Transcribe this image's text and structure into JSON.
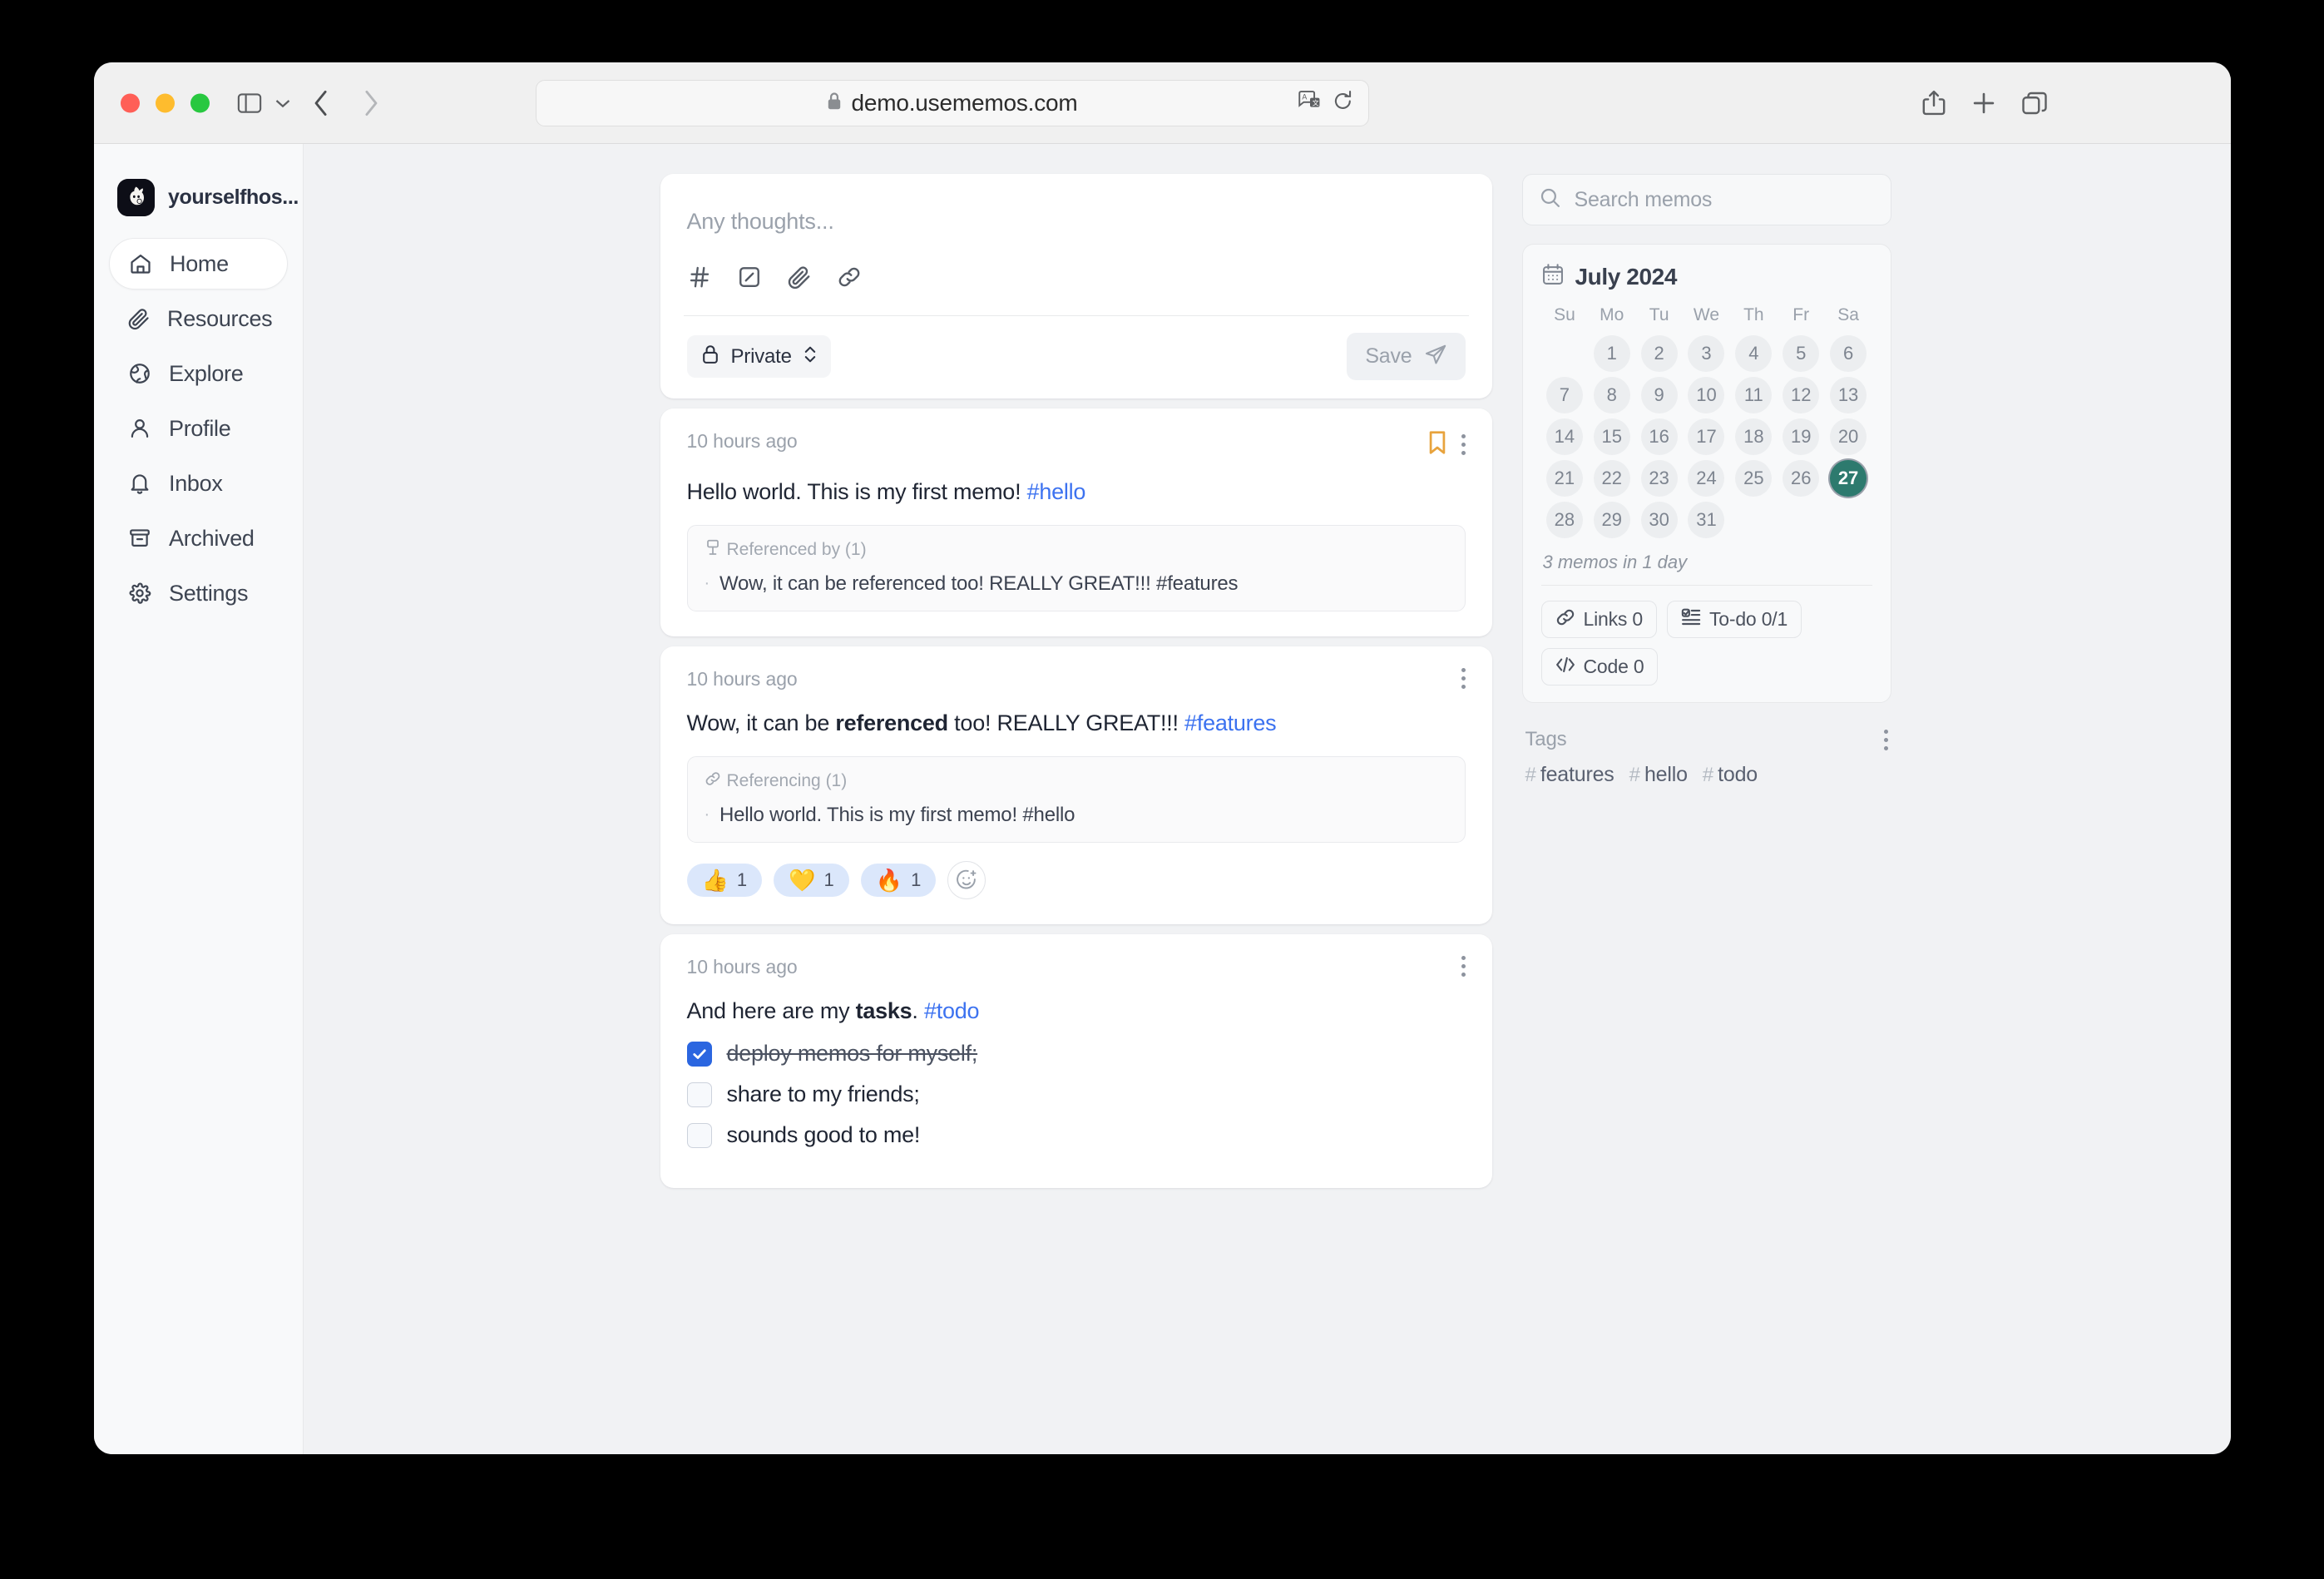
{
  "browser": {
    "url": "demo.usememos.com",
    "lock_icon": "lock-icon",
    "translate_icon": "translate-icon",
    "reload_icon": "reload-icon",
    "share_icon": "share-icon",
    "newtab_icon": "plus-icon",
    "tabs_icon": "tab-overview-icon",
    "back_icon": "chevron-left-icon",
    "forward_icon": "chevron-right-icon",
    "sidebar_icon": "sidebar-toggle-icon",
    "sidebar_chevron_icon": "chevron-down-icon"
  },
  "sidebar": {
    "username": "yourselfhos...",
    "avatar_name": "memos-mascot-avatar",
    "items": [
      {
        "label": "Home",
        "icon": "home-icon",
        "active": true
      },
      {
        "label": "Resources",
        "icon": "paperclip-icon",
        "active": false
      },
      {
        "label": "Explore",
        "icon": "globe-icon",
        "active": false
      },
      {
        "label": "Profile",
        "icon": "user-icon",
        "active": false
      },
      {
        "label": "Inbox",
        "icon": "bell-icon",
        "active": false
      },
      {
        "label": "Archived",
        "icon": "archive-icon",
        "active": false
      },
      {
        "label": "Settings",
        "icon": "gear-icon",
        "active": false
      }
    ]
  },
  "editor": {
    "placeholder": "Any thoughts...",
    "tools": [
      {
        "name": "hashtag-icon"
      },
      {
        "name": "checkbox-icon"
      },
      {
        "name": "paperclip-icon"
      },
      {
        "name": "link-icon"
      }
    ],
    "visibility": "Private",
    "visibility_icon": "lock-icon",
    "save_label": "Save",
    "save_icon": "send-icon",
    "save_enabled": false
  },
  "memos": [
    {
      "time": "10 hours ago",
      "bookmarked": true,
      "segments": [
        {
          "text": "Hello world. This is my first memo! ",
          "style": "plain"
        },
        {
          "text": "#hello",
          "style": "tag"
        }
      ],
      "relation": {
        "title": "Referenced by (1)",
        "icon": "reference-in-icon",
        "items": [
          "Wow, it can be referenced too! REALLY GREAT!!! #features"
        ]
      },
      "reactions": [],
      "tasks": []
    },
    {
      "time": "10 hours ago",
      "bookmarked": false,
      "segments": [
        {
          "text": "Wow, it can be ",
          "style": "plain"
        },
        {
          "text": "referenced",
          "style": "bold"
        },
        {
          "text": " too! REALLY GREAT!!! ",
          "style": "plain"
        },
        {
          "text": "#features",
          "style": "tag"
        }
      ],
      "relation": {
        "title": "Referencing (1)",
        "icon": "link-icon",
        "items": [
          "Hello world. This is my first memo! #hello"
        ]
      },
      "reactions": [
        {
          "emoji": "👍",
          "count": "1",
          "name": "thumbs-up-reaction"
        },
        {
          "emoji": "💛",
          "count": "1",
          "name": "yellow-heart-reaction"
        },
        {
          "emoji": "🔥",
          "count": "1",
          "name": "fire-reaction"
        }
      ],
      "add_reaction_icon": "add-reaction-icon",
      "tasks": []
    },
    {
      "time": "10 hours ago",
      "bookmarked": false,
      "segments": [
        {
          "text": "And here are my ",
          "style": "plain"
        },
        {
          "text": "tasks",
          "style": "bold"
        },
        {
          "text": ". ",
          "style": "plain"
        },
        {
          "text": "#todo",
          "style": "tag"
        }
      ],
      "relation": null,
      "reactions": [],
      "tasks": [
        {
          "label": "deploy memos for myself;",
          "done": true
        },
        {
          "label": "share to my friends;",
          "done": false
        },
        {
          "label": "sounds good to me!",
          "done": false
        }
      ]
    }
  ],
  "search": {
    "placeholder": "Search memos",
    "icon": "search-icon"
  },
  "calendar": {
    "icon": "calendar-icon",
    "month_label": "July 2024",
    "dow": [
      "Su",
      "Mo",
      "Tu",
      "We",
      "Th",
      "Fr",
      "Sa"
    ],
    "leading_blanks": 1,
    "days": [
      1,
      2,
      3,
      4,
      5,
      6,
      7,
      8,
      9,
      10,
      11,
      12,
      13,
      14,
      15,
      16,
      17,
      18,
      19,
      20,
      21,
      22,
      23,
      24,
      25,
      26,
      27,
      28,
      29,
      30,
      31
    ],
    "today": 27,
    "summary": "3 memos in 1 day",
    "stats": [
      {
        "label": "Links 0",
        "icon": "link-icon",
        "name": "links-stat"
      },
      {
        "label": "To-do 0/1",
        "icon": "todo-icon",
        "name": "todo-stat"
      },
      {
        "label": "Code 0",
        "icon": "code-icon",
        "name": "code-stat"
      }
    ]
  },
  "tags": {
    "title": "Tags",
    "menu_icon": "more-vertical-icon",
    "items": [
      "features",
      "hello",
      "todo"
    ]
  },
  "colors": {
    "accent_link": "#3c72f0",
    "bookmark": "#e8a33d",
    "today_bg": "#2d7a6e",
    "reaction_bg": "#dbe7fb",
    "checkbox_checked": "#2b66e0"
  }
}
